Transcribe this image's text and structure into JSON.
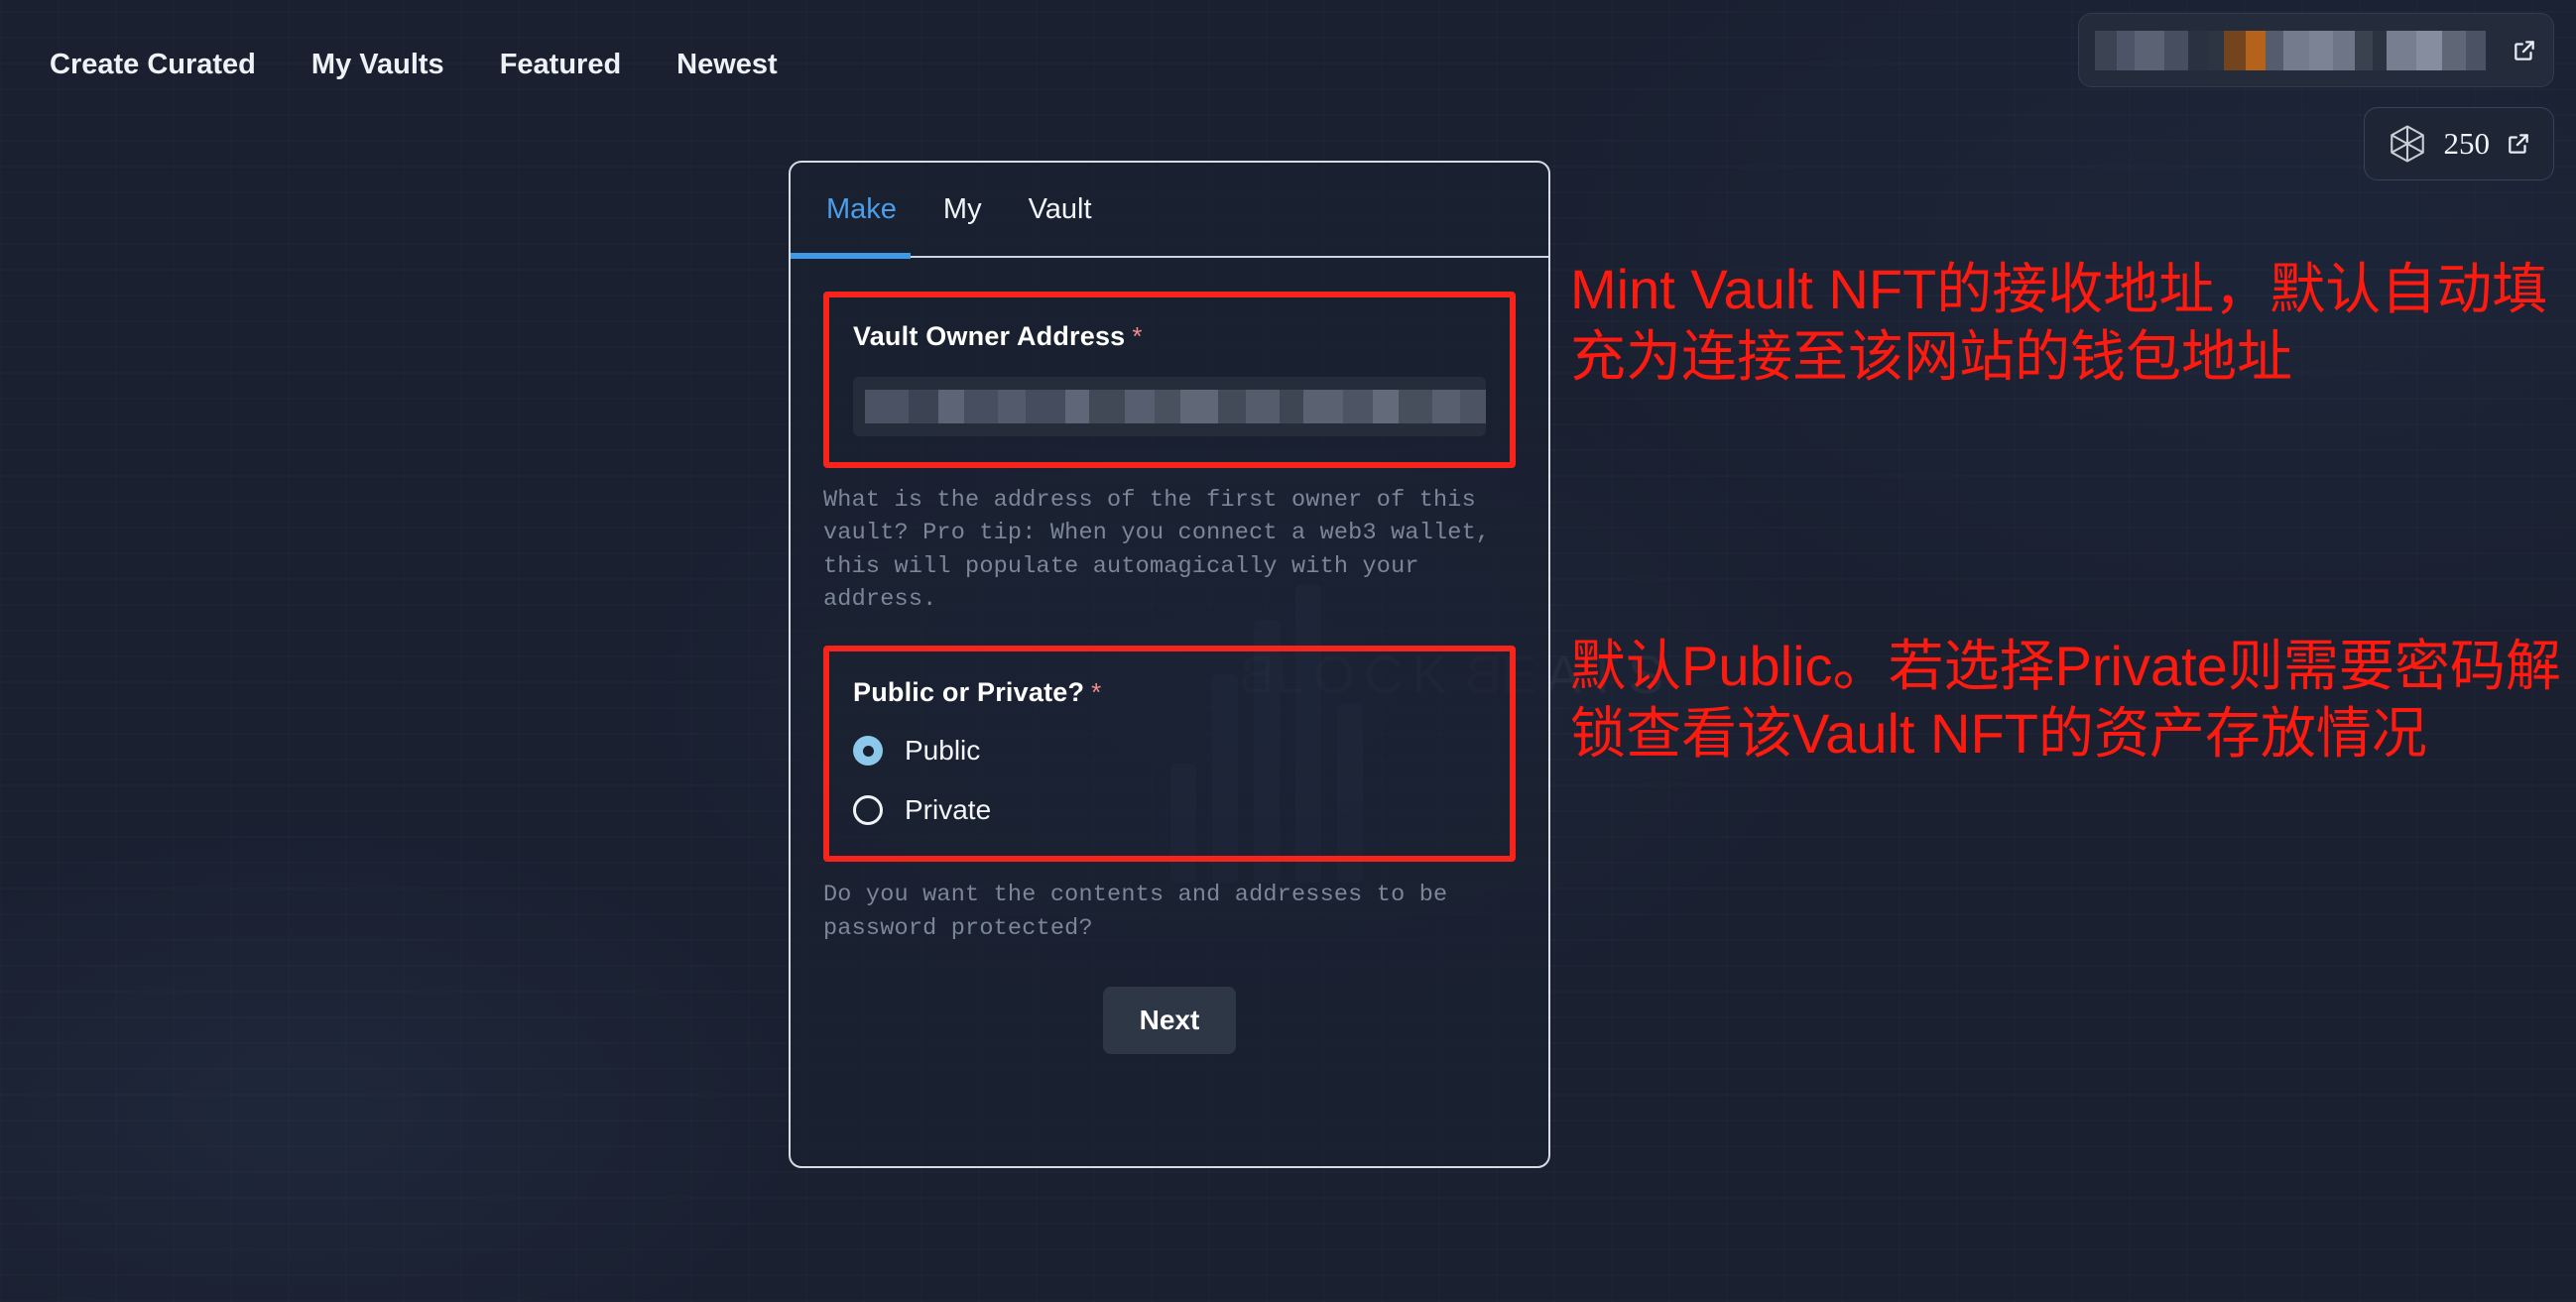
{
  "nav": {
    "items": [
      {
        "label": "Create Curated",
        "name": "nav-create-curated"
      },
      {
        "label": "My Vaults",
        "name": "nav-my-vaults"
      },
      {
        "label": "Featured",
        "name": "nav-featured"
      },
      {
        "label": "Newest",
        "name": "nav-newest"
      }
    ]
  },
  "wallet": {
    "address_redacted": true,
    "external_link_icon": "external-link-icon"
  },
  "token_badge": {
    "amount": "250",
    "cube_icon": "cube-icon",
    "external_link_icon": "external-link-icon"
  },
  "card": {
    "tabs": [
      {
        "label": "Make",
        "active": true
      },
      {
        "label": "My",
        "active": false
      },
      {
        "label": "Vault",
        "active": false
      }
    ],
    "owner_field": {
      "label": "Vault Owner Address",
      "required_marker": "*",
      "value_redacted": true,
      "help": "What is the address of the first owner of this vault? Pro tip: When you connect a web3 wallet, this will populate automagically with your address."
    },
    "privacy_field": {
      "label": "Public or Private?",
      "required_marker": "*",
      "options": [
        {
          "label": "Public",
          "selected": true
        },
        {
          "label": "Private",
          "selected": false
        }
      ],
      "help": "Do you want the contents and addresses to be password protected?"
    },
    "next_label": "Next"
  },
  "annotations": [
    {
      "text": "Mint Vault NFT的接收地址，默认自动填充为连接至该网站的钱包地址"
    },
    {
      "text": "默认Public。若选择Private则需要密码解锁查看该Vault NFT的资产存放情况"
    }
  ],
  "watermark": {
    "text": "BLOCKBEATS"
  },
  "colors": {
    "page_bg": "#1a2030",
    "accent_blue": "#3e9ae6",
    "annotation_red": "#ff1a0f",
    "highlight_box_red": "#f7241c",
    "radio_on": "#8cc8ea",
    "card_border": "#d6dbe4"
  }
}
